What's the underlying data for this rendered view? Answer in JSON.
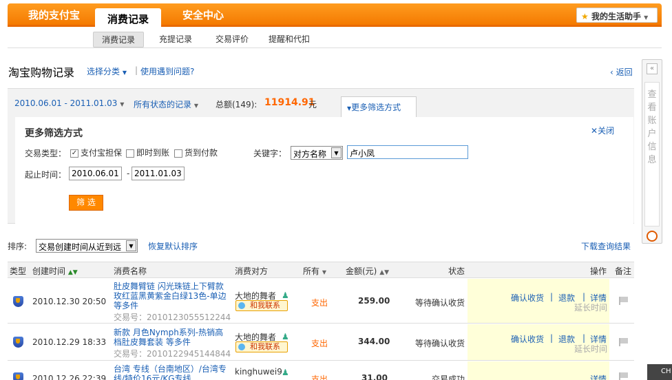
{
  "top_nav": {
    "tabs": [
      {
        "label": "我的支付宝"
      },
      {
        "label": "消费记录"
      },
      {
        "label": "安全中心"
      }
    ],
    "helper_label": "我的生活助手"
  },
  "sub_nav": {
    "items": [
      {
        "label": "消费记录"
      },
      {
        "label": "充提记录"
      },
      {
        "label": "交易评价"
      },
      {
        "label": "提醒和代扣"
      }
    ]
  },
  "page": {
    "title": "淘宝购物记录",
    "select_category": "选择分类",
    "help_link": "使用遇到问题?",
    "back_label": "返回"
  },
  "summary": {
    "date_range": "2010.06.01 - 2011.01.03",
    "status_filter": "所有状态的记录",
    "total_label": "总额(149):",
    "total_amount": "11914.91",
    "currency": "元",
    "more_filters_button": "更多筛选方式"
  },
  "filter_panel": {
    "heading": "更多筛选方式",
    "close_label": "关闭",
    "type_label": "交易类型：",
    "types": [
      {
        "label": "支付宝担保",
        "checked": true
      },
      {
        "label": "即时到账",
        "checked": false
      },
      {
        "label": "货到付款",
        "checked": false
      }
    ],
    "keyword_label": "关键字：",
    "keyword_type": "对方名称",
    "keyword_value": "卢小凤",
    "time_label": "起止时间：",
    "start_date": "2010.06.01",
    "date_separator": "-",
    "end_date": "2011.01.03",
    "submit_label": "筛 选"
  },
  "sort": {
    "label": "排序:",
    "selected": "交易创建时间从近到远",
    "reset_label": "恢复默认排序",
    "download_label": "下载查询结果"
  },
  "table": {
    "headers": {
      "type": "类型",
      "created": "创建时间",
      "name": "消费名称",
      "counterparty": "消费对方",
      "direction": "所有",
      "amount": "金额(元)",
      "status": "状态",
      "action": "操作",
      "note": "备注"
    },
    "rows": [
      {
        "time": "2010.12.30 20:50",
        "name": "肚皮舞臂链 闪光珠链上下臂款玫红蓝黑黄紫金白绿13色-单边等多件",
        "trade_no_label": "交易号：",
        "trade_no": "2010123055512244",
        "counterparty": "大地的舞者",
        "contact": "和我联系",
        "direction": "支出",
        "amount": "259.00",
        "status": "等待确认收货",
        "action_confirm": "确认收货",
        "action_refund": "退款",
        "action_detail": "详情",
        "action_extend": "延长时间"
      },
      {
        "time": "2010.12.29 18:33",
        "name": "新款 月色Nymph系列-热销高档肚皮舞套装 等多件",
        "trade_no_label": "交易号：",
        "trade_no": "2010122945144844",
        "counterparty": "大地的舞者",
        "contact": "和我联系",
        "direction": "支出",
        "amount": "344.00",
        "status": "等待确认收货",
        "action_confirm": "确认收货",
        "action_refund": "退款",
        "action_detail": "详情",
        "action_extend": "延长时间"
      },
      {
        "time": "2010.12.26 22:39",
        "name": "台湾 专线（台南地区）/台湾专线/特价16元/KG专线",
        "counterparty": "kinghuwei9",
        "direction": "支出",
        "amount": "31.00",
        "status": "交易成功",
        "action_detail": "详情"
      }
    ]
  },
  "side_panel": {
    "label": "查看账户信息"
  },
  "corner_label": "CH"
}
